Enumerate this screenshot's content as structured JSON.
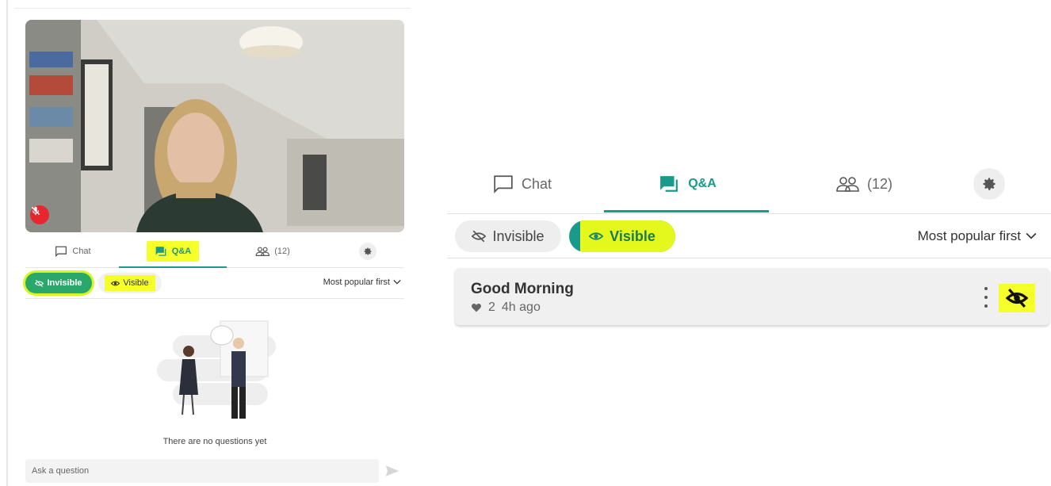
{
  "left": {
    "tabs": {
      "chat_label": "Chat",
      "qa_label": "Q&A",
      "people_count": "(12)"
    },
    "filter": {
      "invisible_label": "Invisible",
      "visible_label": "Visible",
      "sort_label": "Most popular first"
    },
    "empty_state": "There are no questions yet",
    "ask_placeholder": "Ask a question"
  },
  "right": {
    "tabs": {
      "chat_label": "Chat",
      "qa_label": "Q&A",
      "people_count": "(12)"
    },
    "filter": {
      "invisible_label": "Invisible",
      "visible_label": "Visible",
      "sort_label": "Most popular first"
    },
    "question": {
      "title": "Good Morning",
      "likes": "2",
      "time": "4h ago"
    }
  },
  "colors": {
    "accent": "#1a9a8a",
    "highlight": "#f5ff2a",
    "mic_off": "#e8262e"
  }
}
